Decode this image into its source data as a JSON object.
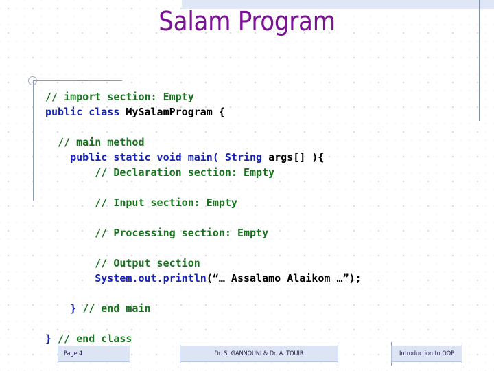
{
  "slide": {
    "title": "Salam Program",
    "title_color": "#7d1196",
    "background_color": "#ffffff",
    "accent_band_color": "#dfe6f5",
    "rule_color": "#8a9ab4"
  },
  "code": {
    "comment_color": "#17731d",
    "keyword_color": "#1622b4",
    "identifier_color": "#000000",
    "lines": [
      {
        "indent": 0,
        "parts": [
          {
            "text": "// import section: Empty",
            "style": "cmt"
          }
        ]
      },
      {
        "indent": 0,
        "parts": [
          {
            "text": "public class ",
            "style": "kw"
          },
          {
            "text": "MySalamProgram {",
            "style": "id"
          }
        ]
      },
      {
        "indent": 0,
        "parts": []
      },
      {
        "indent": 1,
        "parts": [
          {
            "text": "// main method",
            "style": "cmt"
          }
        ]
      },
      {
        "indent": 2,
        "parts": [
          {
            "text": "public static void main( String ",
            "style": "kw"
          },
          {
            "text": "args[] ){",
            "style": "id"
          }
        ]
      },
      {
        "indent": 4,
        "parts": [
          {
            "text": "// Declaration section: Empty",
            "style": "cmt"
          }
        ]
      },
      {
        "indent": 0,
        "parts": []
      },
      {
        "indent": 4,
        "parts": [
          {
            "text": "// Input section: Empty",
            "style": "cmt"
          }
        ]
      },
      {
        "indent": 0,
        "parts": []
      },
      {
        "indent": 4,
        "parts": [
          {
            "text": "// Processing section: Empty",
            "style": "cmt"
          }
        ]
      },
      {
        "indent": 0,
        "parts": []
      },
      {
        "indent": 4,
        "parts": [
          {
            "text": "// Output section",
            "style": "cmt"
          }
        ]
      },
      {
        "indent": 4,
        "parts": [
          {
            "text": "System.out.println",
            "style": "kw"
          },
          {
            "text": "(“… Assalamo Alaikom …”);",
            "style": "id"
          }
        ]
      },
      {
        "indent": 0,
        "parts": []
      },
      {
        "indent": 2,
        "parts": [
          {
            "text": "} ",
            "style": "kw"
          },
          {
            "text": "// end main",
            "style": "cmt"
          }
        ]
      },
      {
        "indent": 0,
        "parts": []
      },
      {
        "indent": 0,
        "parts": [
          {
            "text": "} ",
            "style": "kw"
          },
          {
            "text": "// end class",
            "style": "cmt"
          }
        ]
      }
    ],
    "raw_text": [
      "// import section: Empty",
      "public class MySalamProgram {",
      "",
      "  // main method",
      "    public static void main( String args[] ){",
      "        // Declaration section: Empty",
      "",
      "        // Input section: Empty",
      "",
      "        // Processing section: Empty",
      "",
      "        // Output section",
      "        System.out.println(“… Assalamo Alaikom …”);",
      "",
      "    } // end main",
      "",
      "} // end class"
    ]
  },
  "footer": {
    "page_number": "Page 4",
    "authors": "Dr. S. GANNOUNI & Dr. A. TOUIR",
    "course": "Introduction to OOP",
    "box_fill": "#dde5f4",
    "box_border": "#b9c6e0"
  }
}
